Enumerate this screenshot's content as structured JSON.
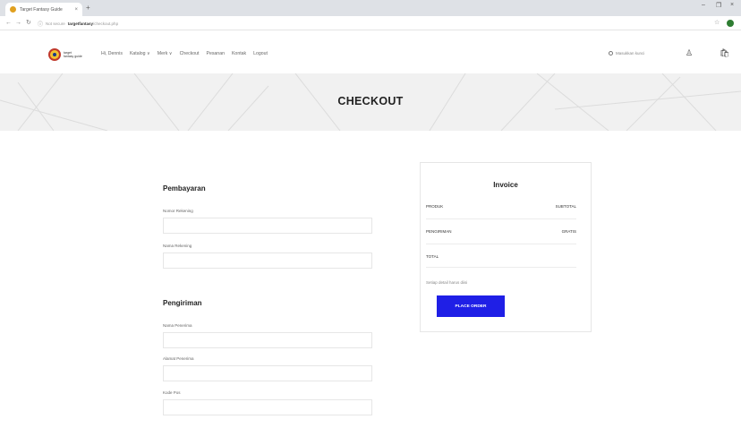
{
  "browser": {
    "tab_title": "Target Fantasy Guide",
    "tab_close": "×",
    "new_tab": "+",
    "win_minimize": "–",
    "win_maximize": "❐",
    "win_close": "×",
    "back": "←",
    "forward": "→",
    "reload": "↻",
    "info": "ⓘ",
    "secure_label": "Not secure",
    "url_host": "targetfantasy",
    "url_path": "/checkout.php",
    "star": "☆"
  },
  "header": {
    "logo_line1": "target",
    "logo_line2": "fantasy guide",
    "nav": [
      "Hi, Dennis",
      "Katalog ∨",
      "Merk ∨",
      "Checkout",
      "Pesanan",
      "Kontak",
      "Logout"
    ],
    "search_placeholder": "Masukkan kunci",
    "account_icon": "♙",
    "cart_icon": "🛍"
  },
  "banner": {
    "title": "CHECKOUT"
  },
  "payment": {
    "title": "Pembayaran",
    "field1_label": "Nomor Rekening",
    "field2_label": "Nama Rekening"
  },
  "shipping": {
    "title": "Pengiriman",
    "field1_label": "Nama Penerima",
    "field2_label": "Alamat Penerima",
    "field3_label": "Kode Pos"
  },
  "invoice": {
    "title": "Invoice",
    "row1_left": "PRODUK",
    "row1_right": "SUBTOTAL",
    "row2_left": "PENGIRIMAN",
    "row2_right": "GRATIS",
    "row3_left": "TOTAL",
    "note": "Setiap detail harus diisi",
    "button": "PLACE ORDER"
  },
  "colors": {
    "accent": "#1f1fe6",
    "banner_bg": "#f1f1f1",
    "profile": "#2e7d32"
  }
}
